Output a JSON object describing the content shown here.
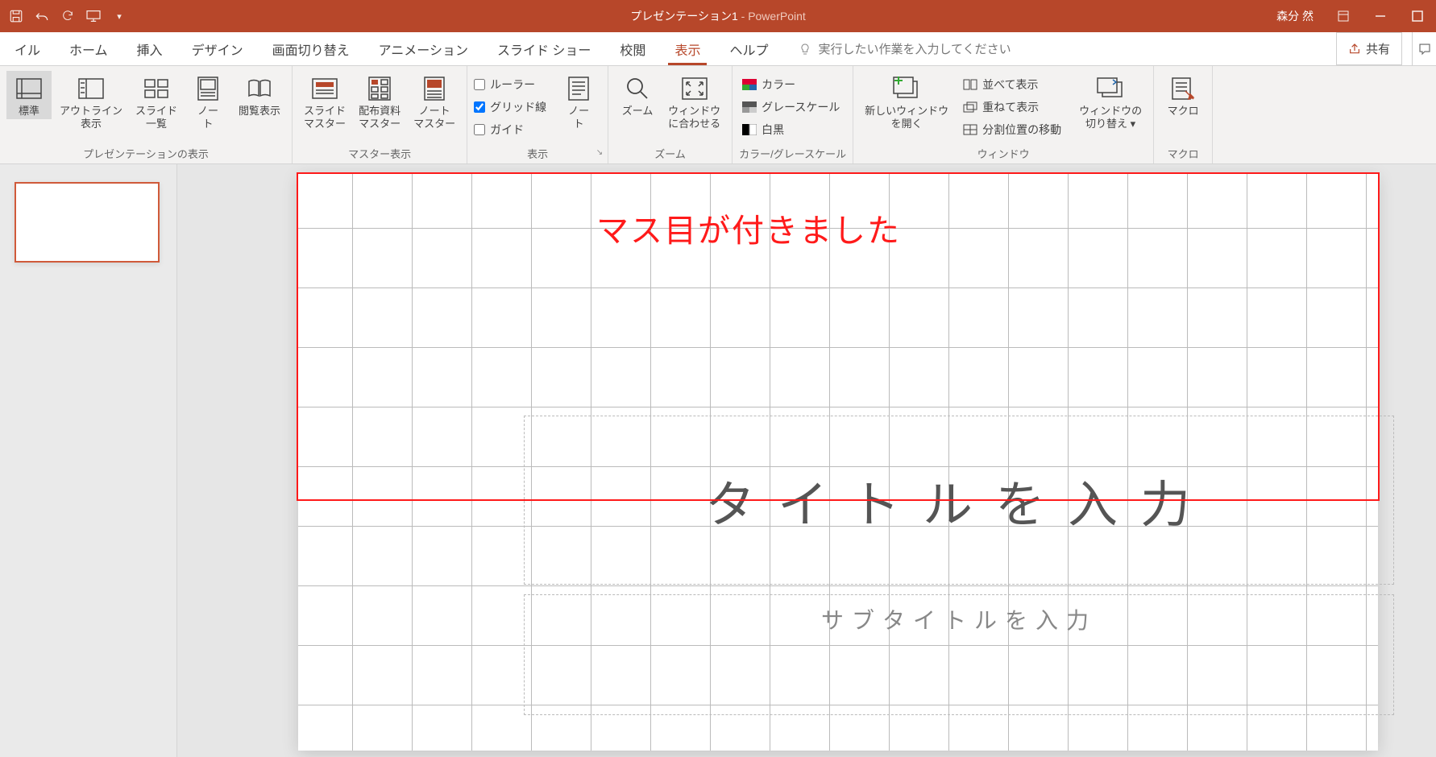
{
  "title": {
    "doc": "プレゼンテーション1",
    "sep": " - ",
    "app": "PowerPoint"
  },
  "user": "森分 然",
  "tabs": [
    "イル",
    "ホーム",
    "挿入",
    "デザイン",
    "画面切り替え",
    "アニメーション",
    "スライド ショー",
    "校閲",
    "表示",
    "ヘルプ"
  ],
  "active_tab": 8,
  "tellme_placeholder": "実行したい作業を入力してください",
  "share_label": "共有",
  "ribbon": {
    "presentation_views": {
      "label": "プレゼンテーションの表示",
      "normal": "標準",
      "outline": "アウトライン\n表示",
      "slide_sorter": "スライド\n一覧",
      "notes_page": "ノー\nト",
      "reading": "閲覧表示"
    },
    "master_views": {
      "label": "マスター表示",
      "slide_master": "スライド\nマスター",
      "handout_master": "配布資料\nマスター",
      "notes_master": "ノート\nマスター"
    },
    "show": {
      "label": "表示",
      "ruler": "ルーラー",
      "gridlines": "グリッド線",
      "guides": "ガイド",
      "gridlines_checked": true,
      "notes": "ノー\nト"
    },
    "zoom": {
      "label": "ズーム",
      "zoom": "ズーム",
      "fit": "ウィンドウ\nに合わせる"
    },
    "color": {
      "label": "カラー/グレースケール",
      "color": "カラー",
      "gray": "グレースケール",
      "bw": "白黒"
    },
    "window": {
      "label": "ウィンドウ",
      "new": "新しいウィンドウ\nを開く",
      "arrange": "並べて表示",
      "cascade": "重ねて表示",
      "split": "分割位置の移動",
      "switch": "ウィンドウの\n切り替え ▾"
    },
    "macros": {
      "label": "マクロ",
      "btn": "マクロ"
    }
  },
  "slide": {
    "title_placeholder": "タイトルを入力",
    "subtitle_placeholder": "サブタイトルを入力"
  },
  "annotation": "マス目が付きました"
}
